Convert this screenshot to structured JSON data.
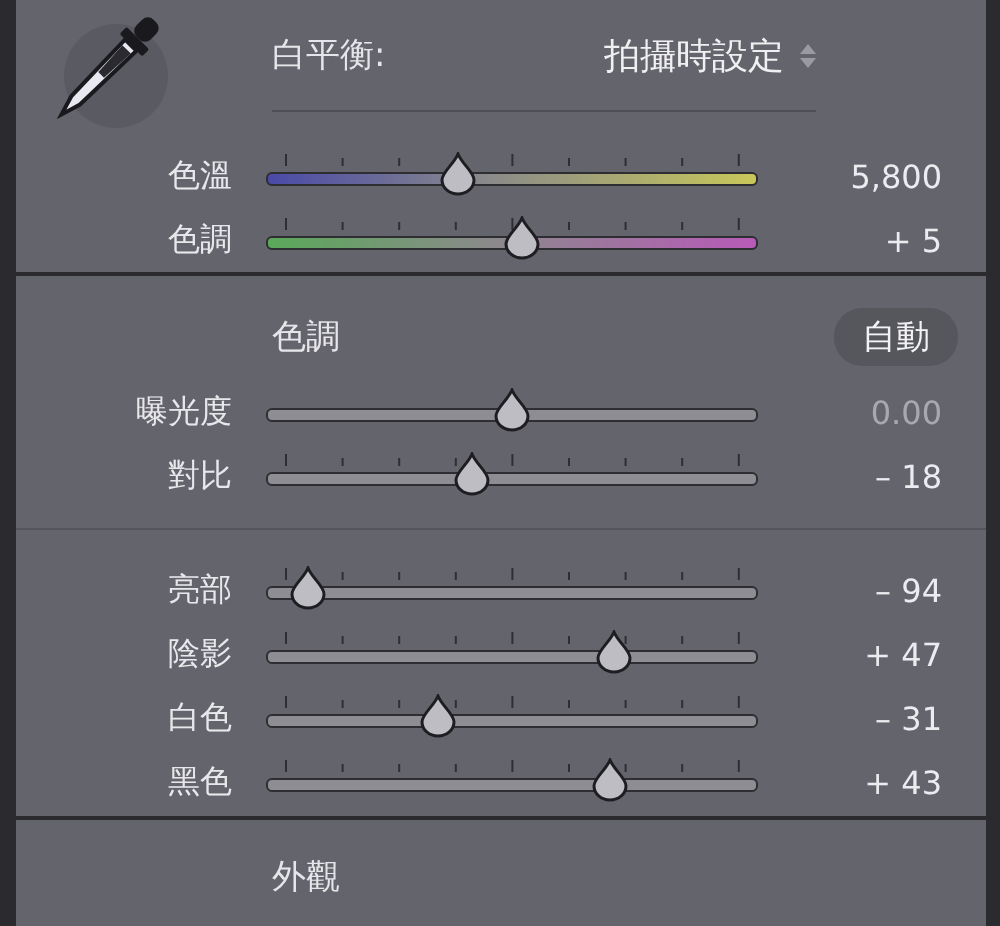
{
  "white_balance": {
    "label": "白平衡:",
    "value": "拍攝時設定",
    "sliders": [
      {
        "label": "色溫",
        "kind": "temp",
        "ticks": true,
        "level": 0.39,
        "value": "5,800",
        "dimmed": false
      },
      {
        "label": "色調",
        "kind": "tint",
        "ticks": true,
        "level": 0.52,
        "value": "+ 5",
        "dimmed": false
      }
    ]
  },
  "tone": {
    "title": "色調",
    "auto_button": "自動",
    "sliders": [
      {
        "label": "曝光度",
        "kind": "plain",
        "ticks": false,
        "level": 0.5,
        "value": "0.00",
        "dimmed": true
      },
      {
        "label": "對比",
        "kind": "plain",
        "ticks": true,
        "level": 0.42,
        "value": "– 18",
        "dimmed": false
      }
    ],
    "sliders_2": [
      {
        "label": "亮部",
        "kind": "plain",
        "ticks": true,
        "level": 0.08,
        "value": "– 94",
        "dimmed": false
      },
      {
        "label": "陰影",
        "kind": "plain",
        "ticks": true,
        "level": 0.71,
        "value": "+ 47",
        "dimmed": false
      },
      {
        "label": "白色",
        "kind": "plain",
        "ticks": true,
        "level": 0.35,
        "value": "– 31",
        "dimmed": false
      },
      {
        "label": "黑色",
        "kind": "plain",
        "ticks": true,
        "level": 0.7,
        "value": "+ 43",
        "dimmed": false
      }
    ]
  },
  "presence": {
    "title": "外觀"
  }
}
